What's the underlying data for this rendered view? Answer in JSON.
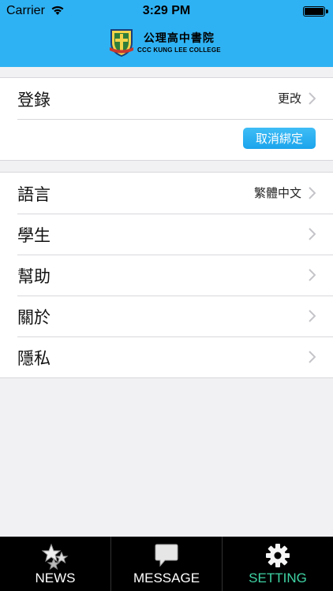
{
  "status_bar": {
    "carrier": "Carrier",
    "time": "3:29 PM"
  },
  "header": {
    "logo_cn": "公理高中書院",
    "logo_en": "CCC KUNG LEE COLLEGE"
  },
  "account": {
    "login_label": "登錄",
    "login_value": "更改",
    "unbind_label": "取消綁定"
  },
  "settings": [
    {
      "label": "語言",
      "value": "繁體中文"
    },
    {
      "label": "學生",
      "value": ""
    },
    {
      "label": "幫助",
      "value": ""
    },
    {
      "label": "關於",
      "value": ""
    },
    {
      "label": "隱私",
      "value": ""
    }
  ],
  "tabs": [
    {
      "label": "NEWS",
      "icon": "news-stars-icon",
      "active": false
    },
    {
      "label": "MESSAGE",
      "icon": "message-bubble-icon",
      "active": false
    },
    {
      "label": "SETTING",
      "icon": "gear-icon",
      "active": true
    }
  ],
  "colors": {
    "header": "#2fb2f3",
    "button": "#1ba4ec",
    "tab_active": "#3fd3a4",
    "tabbar": "#000000"
  }
}
